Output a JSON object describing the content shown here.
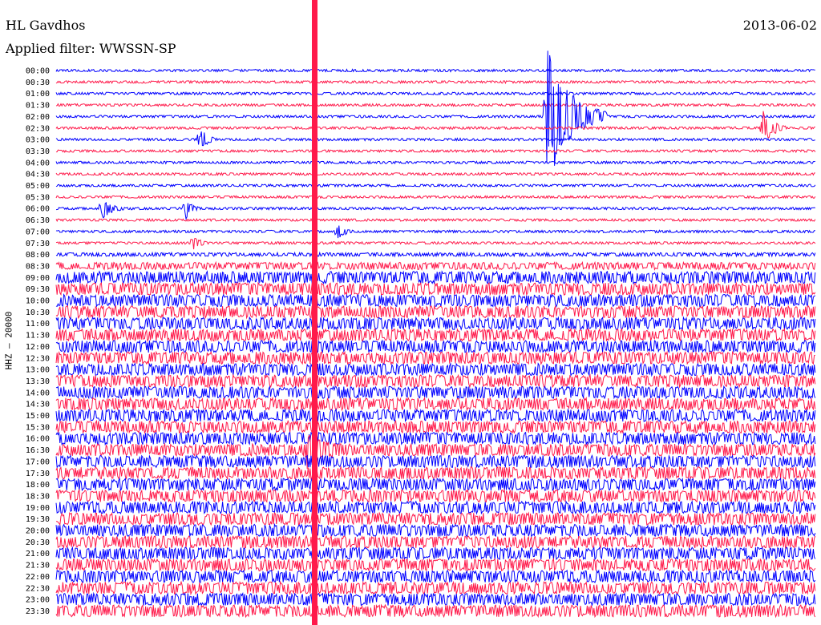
{
  "header": {
    "station": "HL Gavdhos",
    "filter_label": "Applied filter: WWSSN-SP",
    "date": "2013-06-02",
    "channel_label": "HHZ – 20000"
  },
  "chart_data": {
    "type": "line",
    "title": "HL Gavdhos",
    "ylabel": "HHZ – 20000",
    "rows": [
      "00:00",
      "00:30",
      "01:00",
      "01:30",
      "02:00",
      "02:30",
      "03:00",
      "03:30",
      "04:00",
      "04:30",
      "05:00",
      "05:30",
      "06:00",
      "06:30",
      "07:00",
      "07:30",
      "08:00",
      "08:30",
      "09:00",
      "09:30",
      "10:00",
      "10:30",
      "11:00",
      "11:30",
      "12:00",
      "12:30",
      "13:00",
      "13:30",
      "14:00",
      "14:30",
      "15:00",
      "15:30",
      "16:00",
      "16:30",
      "17:00",
      "17:30",
      "18:00",
      "18:30",
      "19:00",
      "19:30",
      "20:00",
      "20:30",
      "21:00",
      "21:30",
      "22:00",
      "22:30",
      "23:00",
      "23:30"
    ],
    "row_colors": [
      "#0000ff",
      "#ff1a4b"
    ],
    "noise_levels": [
      1,
      1,
      1,
      1,
      1,
      1,
      1,
      1,
      1,
      1,
      1,
      1,
      1,
      1,
      1,
      1,
      1.5,
      3,
      5,
      5,
      5,
      5,
      5,
      5,
      5,
      5,
      5,
      5,
      5,
      5,
      5,
      5,
      5,
      5,
      5,
      5,
      5,
      5,
      5,
      5,
      5,
      5,
      5,
      5,
      5,
      5,
      5,
      5
    ],
    "events": [
      {
        "row": 4,
        "x_fraction": 0.645,
        "amplitude": 90,
        "duration": 0.08
      },
      {
        "row": 5,
        "x_fraction": 0.93,
        "amplitude": 25,
        "duration": 0.03
      },
      {
        "row": 6,
        "x_fraction": 0.19,
        "amplitude": 18,
        "duration": 0.02
      },
      {
        "row": 12,
        "x_fraction": 0.06,
        "amplitude": 14,
        "duration": 0.03
      },
      {
        "row": 12,
        "x_fraction": 0.17,
        "amplitude": 14,
        "duration": 0.02
      },
      {
        "row": 14,
        "x_fraction": 0.37,
        "amplitude": 12,
        "duration": 0.02
      },
      {
        "row": 15,
        "x_fraction": 0.18,
        "amplitude": 12,
        "duration": 0.02
      },
      {
        "row": 33,
        "x_fraction": 0.33,
        "amplitude": 20,
        "duration": 0.05
      }
    ],
    "grid": false
  }
}
